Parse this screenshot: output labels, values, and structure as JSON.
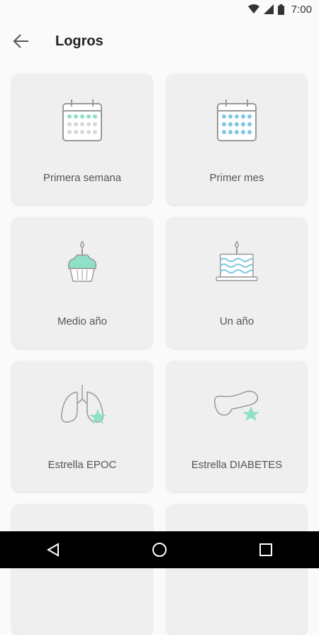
{
  "status": {
    "time": "7:00"
  },
  "header": {
    "title": "Logros"
  },
  "cards": [
    {
      "label": "Primera semana",
      "icon": "calendar-week-icon"
    },
    {
      "label": "Primer mes",
      "icon": "calendar-month-icon"
    },
    {
      "label": "Medio año",
      "icon": "cupcake-icon"
    },
    {
      "label": "Un año",
      "icon": "birthday-cake-icon"
    },
    {
      "label": "Estrella EPOC",
      "icon": "lungs-star-icon"
    },
    {
      "label": "Estrella DIABETES",
      "icon": "pancreas-star-icon"
    }
  ],
  "colors": {
    "accent": "#8ee0c8",
    "blue_dots": "#7ec8e0",
    "icon_gray": "#9a9a9a"
  }
}
